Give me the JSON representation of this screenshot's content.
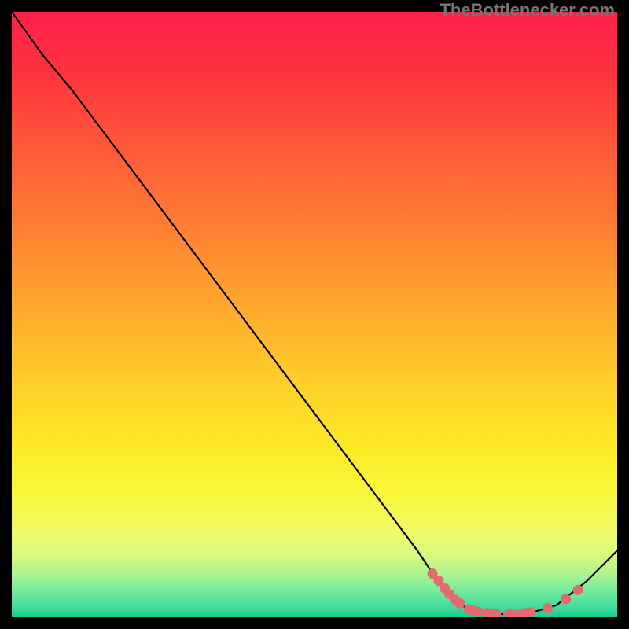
{
  "attribution": "TheBottlenecker.com",
  "chart_data": {
    "type": "line",
    "title": "",
    "xlabel": "",
    "ylabel": "",
    "xlim": [
      0,
      100
    ],
    "ylim": [
      0,
      100
    ],
    "series": [
      {
        "name": "curve",
        "points": [
          {
            "x": 0,
            "y": 100
          },
          {
            "x": 5,
            "y": 93
          },
          {
            "x": 10,
            "y": 87
          },
          {
            "x": 67,
            "y": 11
          },
          {
            "x": 71,
            "y": 5
          },
          {
            "x": 75,
            "y": 1.5
          },
          {
            "x": 80,
            "y": 0.5
          },
          {
            "x": 85,
            "y": 0.5
          },
          {
            "x": 90,
            "y": 2
          },
          {
            "x": 95,
            "y": 6
          },
          {
            "x": 100,
            "y": 11
          }
        ]
      }
    ],
    "markers": [
      {
        "x": 69.5,
        "y": 7.2
      },
      {
        "x": 70.5,
        "y": 6.0
      },
      {
        "x": 71.5,
        "y": 4.8
      },
      {
        "x": 72.3,
        "y": 3.8
      },
      {
        "x": 73.2,
        "y": 2.9
      },
      {
        "x": 74.0,
        "y": 2.3
      },
      {
        "x": 75.5,
        "y": 1.3
      },
      {
        "x": 76.3,
        "y": 1.1
      },
      {
        "x": 77.0,
        "y": 0.9
      },
      {
        "x": 78.5,
        "y": 0.7
      },
      {
        "x": 79.2,
        "y": 0.6
      },
      {
        "x": 80.0,
        "y": 0.5
      },
      {
        "x": 82.0,
        "y": 0.5
      },
      {
        "x": 82.8,
        "y": 0.5
      },
      {
        "x": 84.3,
        "y": 0.6
      },
      {
        "x": 85.0,
        "y": 0.7
      },
      {
        "x": 85.7,
        "y": 0.8
      },
      {
        "x": 88.5,
        "y": 1.5
      },
      {
        "x": 91.5,
        "y": 3.0
      },
      {
        "x": 93.5,
        "y": 4.5
      }
    ],
    "gradient_stops": [
      {
        "offset": 0.0,
        "color": "#ff1f4b"
      },
      {
        "offset": 0.1,
        "color": "#ff333f"
      },
      {
        "offset": 0.22,
        "color": "#ff5838"
      },
      {
        "offset": 0.35,
        "color": "#ff7d33"
      },
      {
        "offset": 0.48,
        "color": "#ffa62e"
      },
      {
        "offset": 0.6,
        "color": "#ffcc29"
      },
      {
        "offset": 0.72,
        "color": "#fcea26"
      },
      {
        "offset": 0.8,
        "color": "#f8f83a"
      },
      {
        "offset": 0.86,
        "color": "#f0fb6a"
      },
      {
        "offset": 0.9,
        "color": "#d6f97e"
      },
      {
        "offset": 0.93,
        "color": "#a8f391"
      },
      {
        "offset": 0.96,
        "color": "#6fe99d"
      },
      {
        "offset": 0.985,
        "color": "#3bdc9e"
      },
      {
        "offset": 1.0,
        "color": "#14cf8e"
      }
    ],
    "marker_color": "#e56a6f",
    "line_color": "#000000"
  }
}
